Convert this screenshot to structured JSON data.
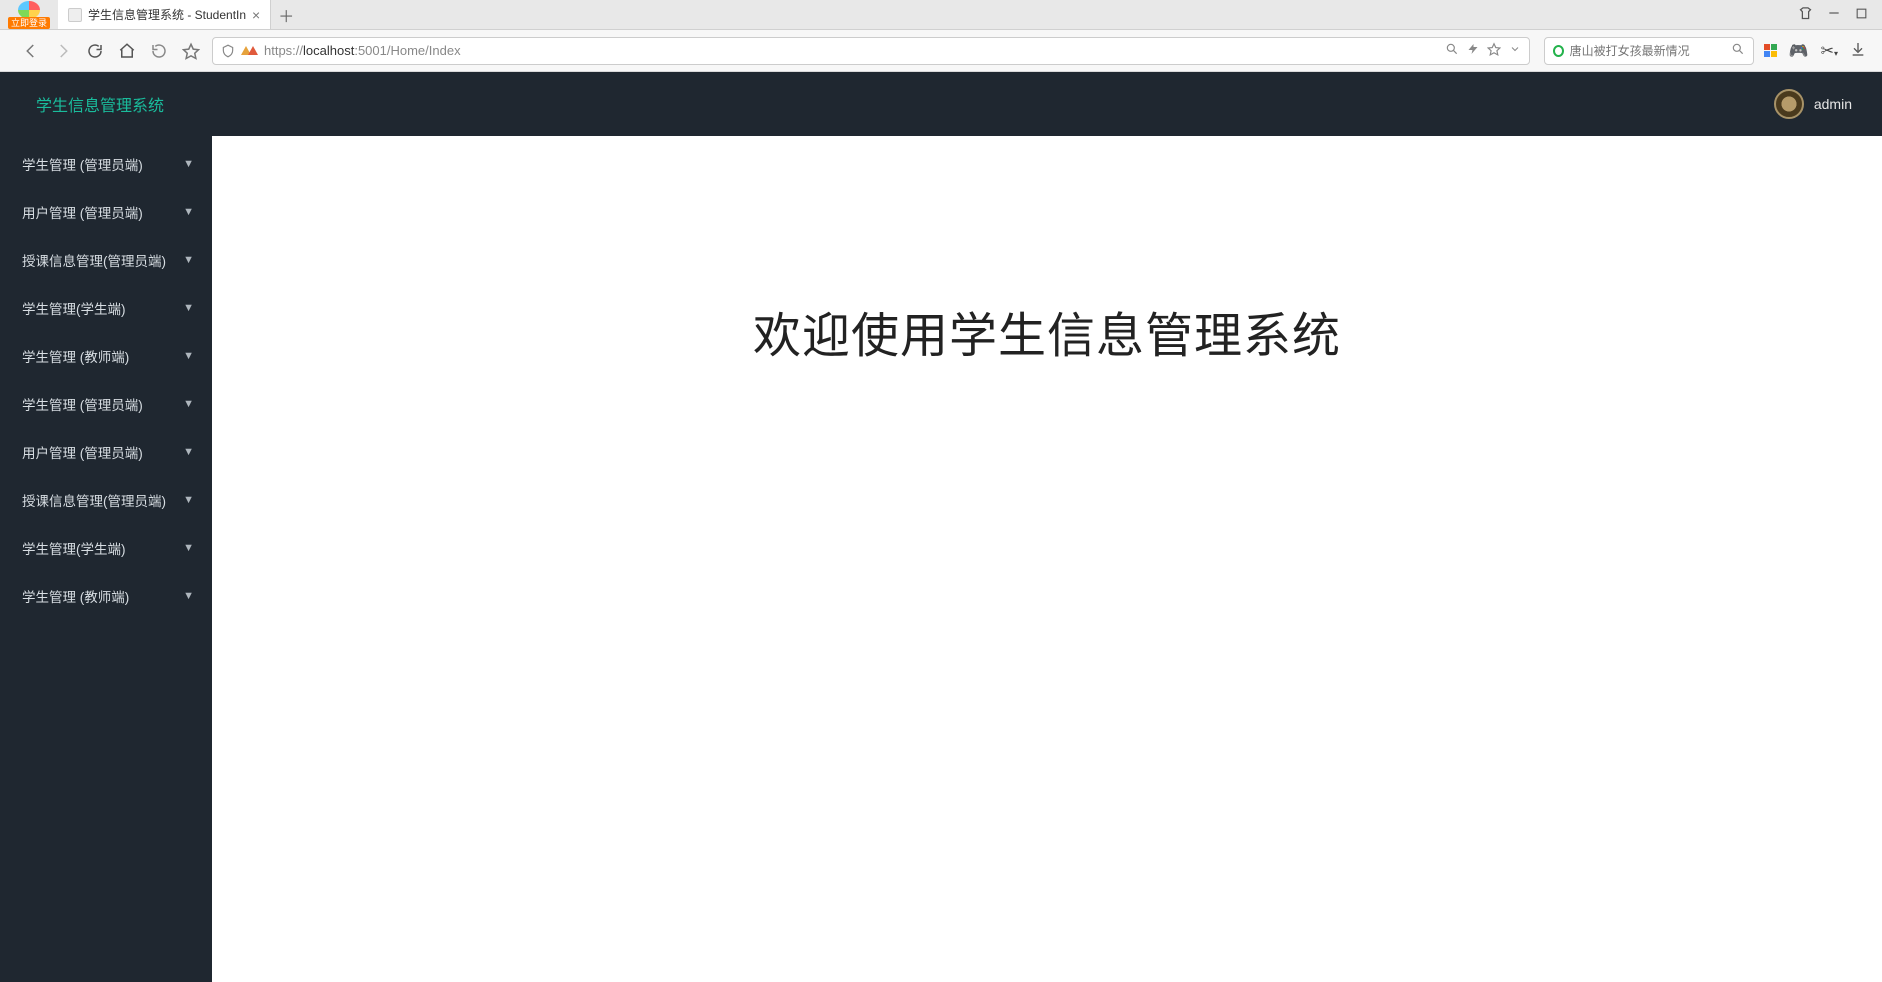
{
  "browser": {
    "login_badge": "立即登录",
    "tab_title": "学生信息管理系统 - StudentIn",
    "url_prefix": "https://",
    "url_host": "localhost",
    "url_rest": ":5001/Home/Index",
    "search_placeholder": "唐山被打女孩最新情况"
  },
  "app": {
    "title": "学生信息管理系统",
    "username": "admin",
    "welcome_heading": "欢迎使用学生信息管理系统"
  },
  "menu": [
    {
      "label": "学生管理 (管理员端)"
    },
    {
      "label": "用户管理 (管理员端)"
    },
    {
      "label": "授课信息管理(管理员端)"
    },
    {
      "label": "学生管理(学生端)"
    },
    {
      "label": "学生管理 (教师端)"
    },
    {
      "label": "学生管理 (管理员端)"
    },
    {
      "label": "用户管理 (管理员端)"
    },
    {
      "label": "授课信息管理(管理员端)"
    },
    {
      "label": "学生管理(学生端)"
    },
    {
      "label": "学生管理 (教师端)"
    }
  ]
}
